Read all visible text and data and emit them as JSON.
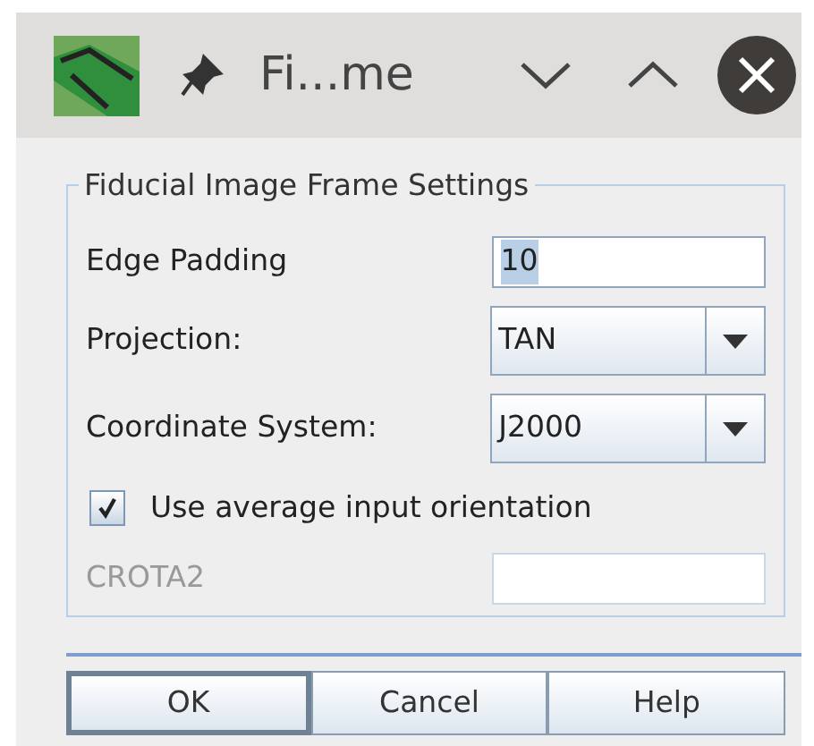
{
  "window": {
    "title": "Fi...me"
  },
  "group": {
    "title": "Fiducial Image Frame Settings"
  },
  "fields": [
    {
      "kind": "text",
      "label": "Edge Padding",
      "value": "10",
      "text_selected": true,
      "disabled": false
    },
    {
      "kind": "combo",
      "label": "Projection:",
      "value": "TAN",
      "disabled": false
    },
    {
      "kind": "combo",
      "label": "Coordinate System:",
      "value": "J2000",
      "disabled": false
    },
    {
      "kind": "checkbox",
      "label": "Use average input orientation",
      "checked": true,
      "disabled": false
    },
    {
      "kind": "text",
      "label": "CROTA2",
      "disabled": true
    }
  ],
  "buttons": [
    {
      "label": "OK",
      "default": true
    },
    {
      "label": "Cancel",
      "default": false
    },
    {
      "label": "Help",
      "default": false
    }
  ]
}
